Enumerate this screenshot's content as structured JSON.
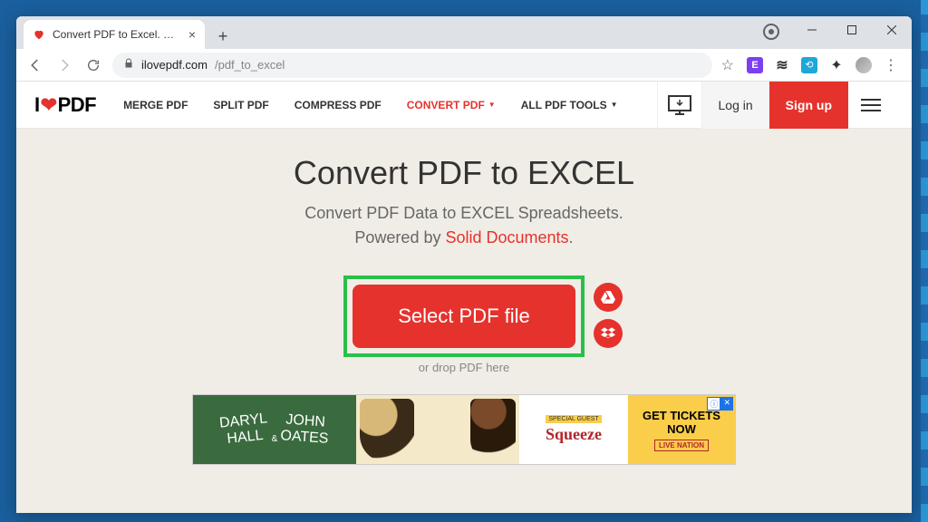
{
  "browser": {
    "tab_title": "Convert PDF to Excel. PDF to XLS",
    "url_domain": "ilovepdf.com",
    "url_path": "/pdf_to_excel"
  },
  "site": {
    "logo_prefix": "I",
    "logo_suffix": "PDF",
    "nav": {
      "merge": "MERGE PDF",
      "split": "SPLIT PDF",
      "compress": "COMPRESS PDF",
      "convert": "CONVERT PDF",
      "all": "ALL PDF TOOLS"
    },
    "login": "Log in",
    "signup": "Sign up"
  },
  "page": {
    "heading": "Convert PDF to EXCEL",
    "sub_line1": "Convert PDF Data to EXCEL Spreadsheets.",
    "sub_powered": "Powered by ",
    "sub_link": "Solid Documents",
    "select_button": "Select PDF file",
    "drop_hint": "or drop PDF here"
  },
  "ad": {
    "left_html": "DARYL HALL & JOHN OATES",
    "special_guest": "SPECIAL GUEST",
    "squeeze": "Squeeze",
    "cta_line1": "GET TICKETS",
    "cta_line2": "NOW",
    "livenation": "LIVE NATION"
  }
}
